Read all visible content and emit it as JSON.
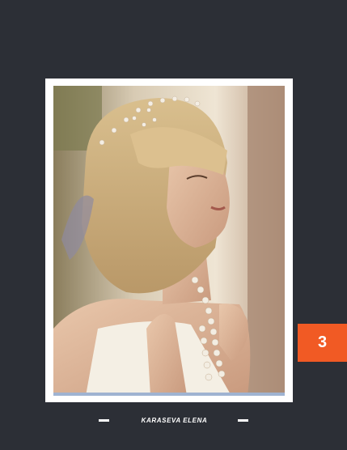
{
  "page": {
    "number": "3",
    "accent_color": "#f15a24",
    "background_color": "#2c2f36"
  },
  "photo": {
    "subject": "portrait-photo"
  },
  "caption": {
    "author": "KARASEVA ELENA"
  }
}
